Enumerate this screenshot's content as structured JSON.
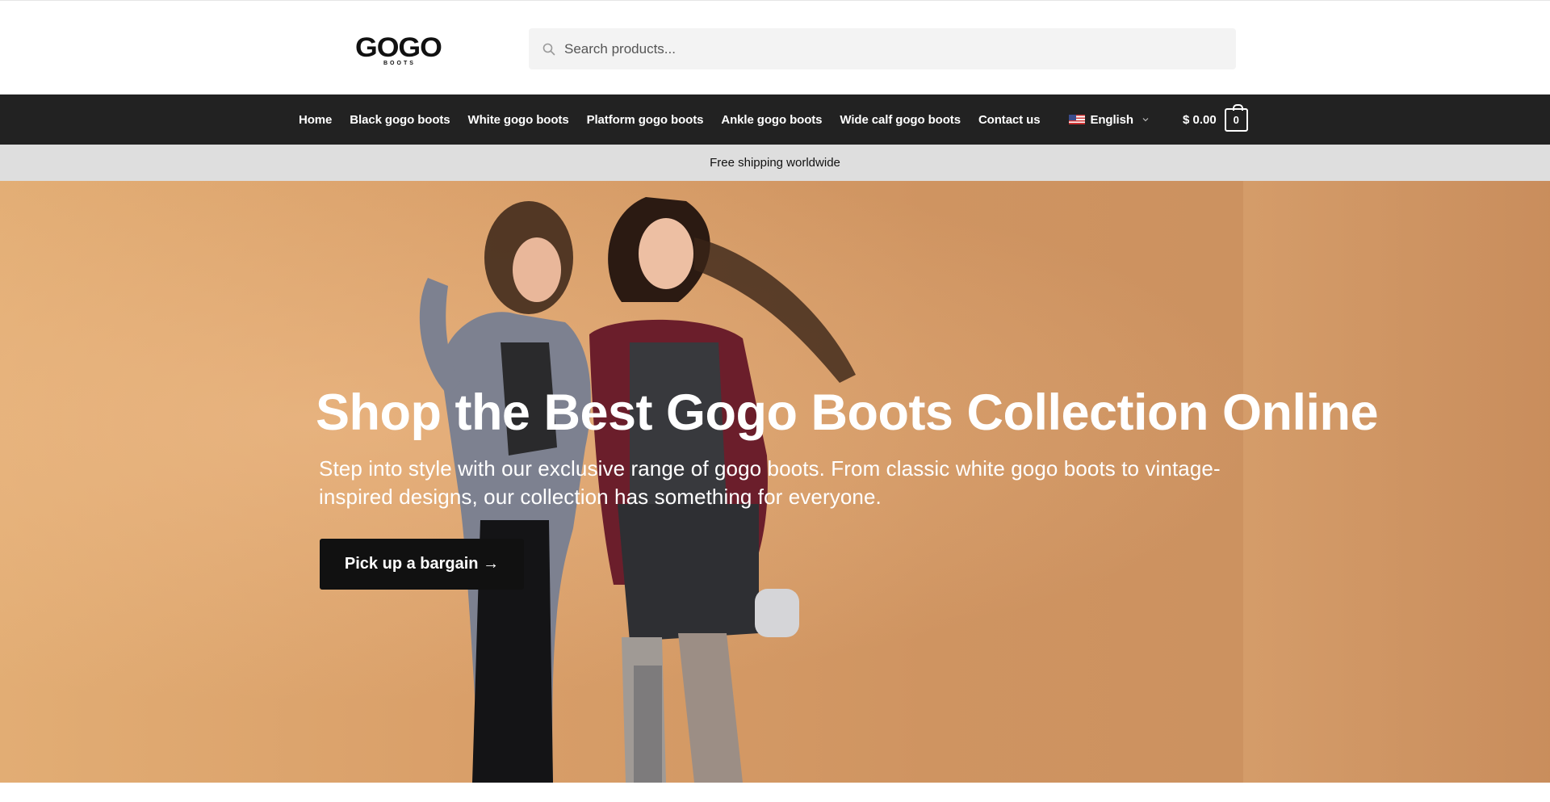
{
  "header": {
    "logo_text": "GOGO",
    "logo_sub": "BOOTS",
    "search_placeholder": "Search products..."
  },
  "nav": {
    "items": [
      {
        "label": "Home"
      },
      {
        "label": "Black gogo boots"
      },
      {
        "label": "White gogo boots"
      },
      {
        "label": "Platform gogo boots"
      },
      {
        "label": "Ankle gogo boots"
      },
      {
        "label": "Wide calf gogo boots"
      },
      {
        "label": "Contact us"
      }
    ],
    "language": "English",
    "cart": {
      "amount": "$ 0.00",
      "count": "0"
    }
  },
  "promo": {
    "text": "Free shipping worldwide"
  },
  "hero": {
    "title": "Shop the Best Gogo Boots Collection Online",
    "description": "Step into style with our exclusive range of gogo boots. From classic white gogo boots to vintage-inspired designs, our collection has something for everyone.",
    "cta_label": "Pick up a bargain →"
  },
  "colors": {
    "navbar": "#222222",
    "promo_bar": "#dedede",
    "hero_bg": "#d99f69",
    "cta_bg": "#111111"
  }
}
